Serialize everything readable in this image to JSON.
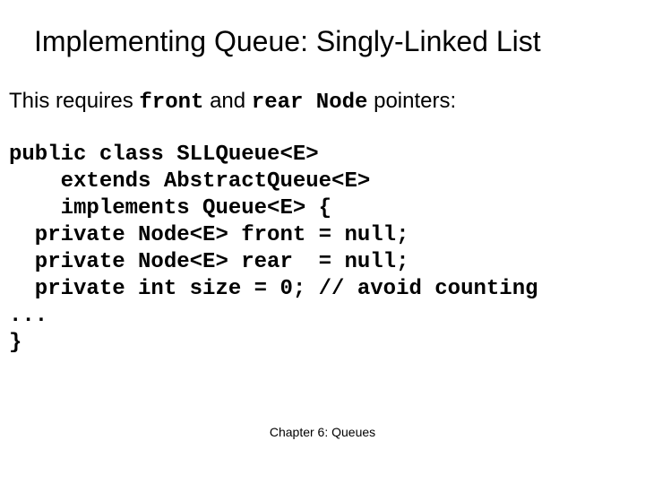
{
  "title": "Implementing Queue: Singly-Linked List",
  "intro": {
    "pre": "This requires ",
    "kw1": "front",
    "mid": " and ",
    "kw2": "rear Node",
    "post": " pointers:"
  },
  "code": "public class SLLQueue<E>\n    extends AbstractQueue<E>\n    implements Queue<E> {\n  private Node<E> front = null;\n  private Node<E> rear  = null;\n  private int size = 0; // avoid counting\n...\n}",
  "footer": "Chapter 6: Queues"
}
